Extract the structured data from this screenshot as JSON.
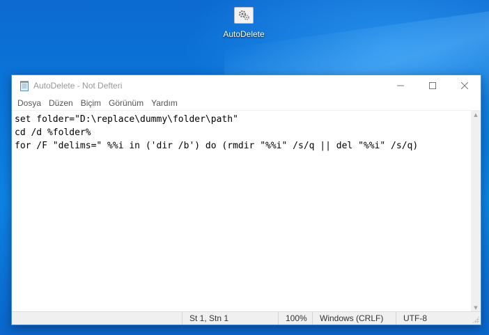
{
  "desktop": {
    "shortcut": {
      "label": "AutoDelete",
      "icon": "gear-file-icon"
    }
  },
  "window": {
    "title": "AutoDelete - Not Defteri",
    "app_icon": "notepad-icon",
    "controls": {
      "minimize": "─",
      "maximize": "☐",
      "close": "✕"
    },
    "menu": [
      "Dosya",
      "Düzen",
      "Biçim",
      "Görünüm",
      "Yardım"
    ],
    "content_lines": [
      "set folder=\"D:\\replace\\dummy\\folder\\path\"",
      "cd /d %folder%",
      "for /F \"delims=\" %%i in ('dir /b') do (rmdir \"%%i\" /s/q || del \"%%i\" /s/q)"
    ],
    "status": {
      "position": "St 1, Stn 1",
      "zoom": "100%",
      "line_endings": "Windows (CRLF)",
      "encoding": "UTF-8"
    }
  }
}
